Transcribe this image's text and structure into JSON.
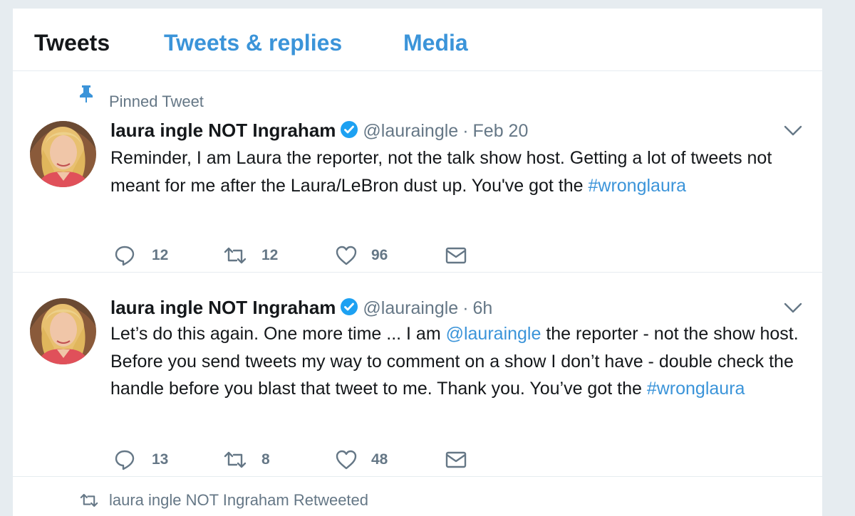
{
  "tabs": {
    "tweets": "Tweets",
    "replies": "Tweets & replies",
    "media": "Media"
  },
  "colors": {
    "link": "#3b94d9",
    "secondary": "#657786",
    "text": "#14171a",
    "background": "#e6ecf0"
  },
  "pinned_label": "Pinned Tweet",
  "tweets": [
    {
      "name": "laura ingle NOT Ingraham",
      "handle": "@lauraingle",
      "dot": "·",
      "time": "Feb 20",
      "text_1": "Reminder, I am Laura the reporter, not the talk show host.   Getting a lot of tweets not meant for me after the Laura/LeBron dust up. You've got the ",
      "hashtag": "#wronglaura",
      "replies": "12",
      "retweets": "12",
      "likes": "96"
    },
    {
      "name": "laura ingle NOT Ingraham",
      "handle": "@lauraingle",
      "dot": "·",
      "time": "6h",
      "text_1": "Let’s do this again.  One more time ... I am ",
      "mention": "@lauraingle",
      "text_2": " the reporter - not the show host.  Before you send tweets my way to comment on a show I don’t have - double check the handle before you blast that tweet to me.  Thank you. You’ve got the ",
      "hashtag": "#wronglaura",
      "replies": "13",
      "retweets": "8",
      "likes": "48"
    }
  ],
  "retweet_context": "laura ingle NOT Ingraham Retweeted",
  "icons": {
    "pin": "pin-icon",
    "verified": "verified-badge-icon",
    "caret": "chevron-down-icon",
    "reply": "reply-icon",
    "retweet": "retweet-icon",
    "like": "heart-icon",
    "dm": "envelope-icon"
  }
}
